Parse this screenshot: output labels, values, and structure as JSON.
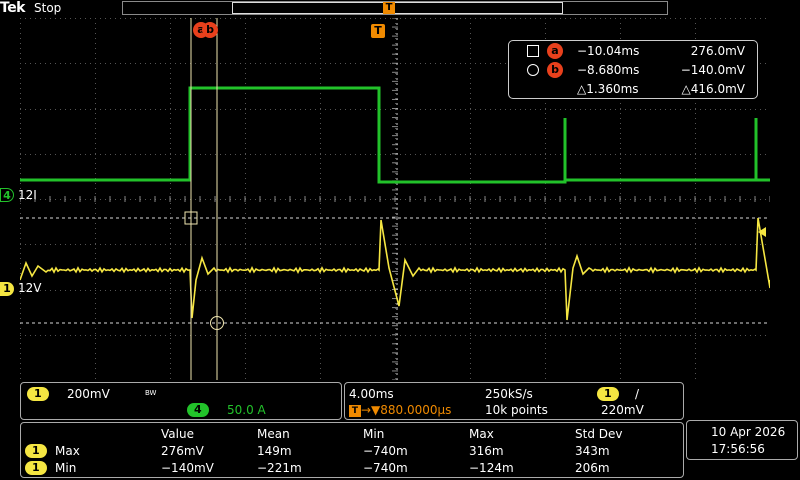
{
  "header": {
    "brand": "Tek",
    "acquisition_state": "Stop",
    "trigger_marker": "T"
  },
  "graticule": {
    "cursor_a_label": "a",
    "cursor_b_label": "b",
    "trigger_position_label": "T",
    "colors": {
      "ch1": "#f5e642",
      "ch4": "#22c22a",
      "cursor": "#f0e6b0",
      "trigger": "#f08a00",
      "cursor_badge": "#e8401c"
    }
  },
  "channels": {
    "ch4": {
      "number": "4",
      "label": "12I"
    },
    "ch1": {
      "number": "1",
      "label": "12V"
    }
  },
  "cursor_readout": {
    "a": {
      "label": "a",
      "time": "−10.04ms",
      "value": "276.0mV"
    },
    "b": {
      "label": "b",
      "time": "−8.680ms",
      "value": "−140.0mV"
    },
    "delta": {
      "time": "△1.360ms",
      "value": "△416.0mV"
    }
  },
  "channel_panel": {
    "ch1_number": "1",
    "ch1_scale": "200mV",
    "bw_limit": "BW",
    "ch4_number": "4",
    "ch4_scale": "50.0 A"
  },
  "timebase_panel": {
    "horizontal_scale": "4.00ms",
    "sample_rate": "250kS/s",
    "trigger_source": "1",
    "trigger_slope": "/",
    "trigger_offset_marker": "T",
    "trigger_offset": "→▼880.0000µs",
    "record_length": "10k points",
    "trigger_level": "220mV"
  },
  "measurements": {
    "headers": [
      "Value",
      "Mean",
      "Min",
      "Max",
      "Std Dev"
    ],
    "rows": [
      {
        "channel": "1",
        "name": "Max",
        "cells": [
          "276mV",
          "149m",
          "−740m",
          "316m",
          "343m"
        ]
      },
      {
        "channel": "1",
        "name": "Min",
        "cells": [
          "−140mV",
          "−221m",
          "−740m",
          "−124m",
          "206m"
        ]
      }
    ]
  },
  "clock": {
    "date": "10 Apr  2026",
    "time": "17:56:56"
  }
}
